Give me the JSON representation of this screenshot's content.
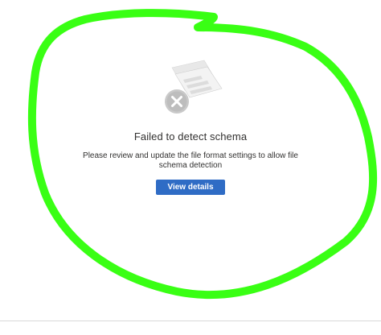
{
  "empty_state": {
    "icon": "file-error-icon",
    "title": "Failed to detect schema",
    "message": "Please review and update the file format settings to allow file schema detection",
    "button_label": "View details"
  },
  "colors": {
    "annotation": "#39ff14",
    "button": "#2f6cc5",
    "text": "#323130"
  }
}
